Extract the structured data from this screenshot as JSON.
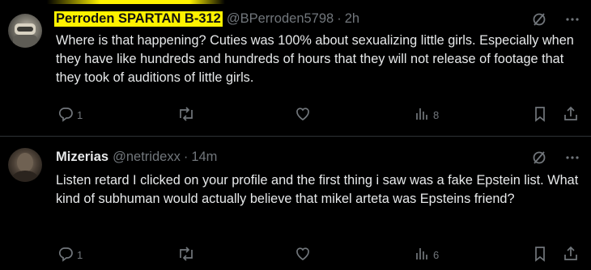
{
  "tweets": [
    {
      "author_name": "Perroden SPARTAN B-312",
      "handle": "@BPerroden5798",
      "separator": "·",
      "time": "2h",
      "text": "Where is that happening? Cuties was 100% about sexualizing little girls. Especially when they have like hundreds and hundreds of hours that they will not release of footage that they took of auditions of little girls.",
      "reply_count": "1",
      "retweet_count": "",
      "like_count": "",
      "view_count": "8"
    },
    {
      "author_name": "Mizerias",
      "handle": "@netridexx",
      "separator": "·",
      "time": "14m",
      "text": "Listen retard I clicked on your profile and the first thing i saw was a fake Epstein list. What kind of subhuman would actually believe that  mikel arteta was Epsteins friend?",
      "reply_count": "1",
      "retweet_count": "",
      "like_count": "",
      "view_count": "6"
    }
  ],
  "icons": {
    "grok": "grok-slash-icon",
    "more": "more-horizontal-icon",
    "reply": "reply-icon",
    "retweet": "retweet-icon",
    "like": "heart-icon",
    "views": "views-bar-icon",
    "bookmark": "bookmark-icon",
    "share": "share-icon"
  },
  "colors": {
    "background": "#000000",
    "text": "#e7e9ea",
    "muted": "#71767b",
    "highlight": "#fff200",
    "divider": "#2f3336"
  }
}
